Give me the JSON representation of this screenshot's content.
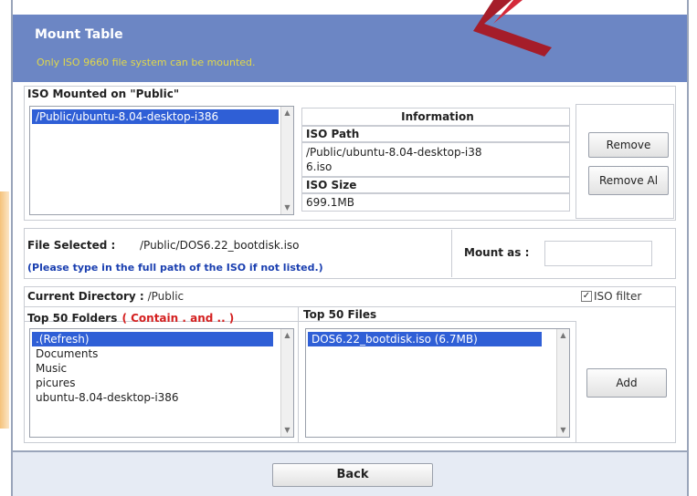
{
  "header": {
    "title": "Mount Table",
    "subtitle": "Only ISO 9660 file system can be mounted."
  },
  "mounted": {
    "title": "ISO Mounted on \"Public\"",
    "items": [
      "/Public/ubuntu-8.04-desktop-i386"
    ],
    "info": {
      "heading": "Information",
      "path_label": "ISO Path",
      "path_value_line1": "/Public/ubuntu-8.04-desktop-i38",
      "path_value_line2": "6.iso",
      "size_label": "ISO Size",
      "size_value": "699.1MB"
    },
    "remove_label": "Remove",
    "remove_all_label": "Remove Al"
  },
  "file": {
    "selected_label": "File Selected :",
    "selected_value": "/Public/DOS6.22_bootdisk.iso",
    "hint": "(Please type in the full path of the ISO if not listed.)",
    "mount_as_label": "Mount as :",
    "mount_as_value": ""
  },
  "browser": {
    "current_dir_label": "Current Directory :",
    "current_dir_value": "/Public",
    "iso_filter_label": "ISO filter",
    "iso_filter_checked": true,
    "folders_title": "Top 50 Folders",
    "folders_note": "( Contain . and .. )",
    "folders": [
      ".(Refresh)",
      "Documents",
      "Music",
      "picures",
      "ubuntu-8.04-desktop-i386"
    ],
    "files_title": "Top 50 Files",
    "files": [
      "DOS6.22_bootdisk.iso (6.7MB)"
    ],
    "add_label": "Add"
  },
  "footer": {
    "back_label": "Back"
  },
  "colors": {
    "header_bg": "#6c86c4",
    "subtitle": "#e0d84a",
    "hint": "#1a3fb0",
    "note": "#d42020",
    "selection": "#2f5fd6"
  }
}
